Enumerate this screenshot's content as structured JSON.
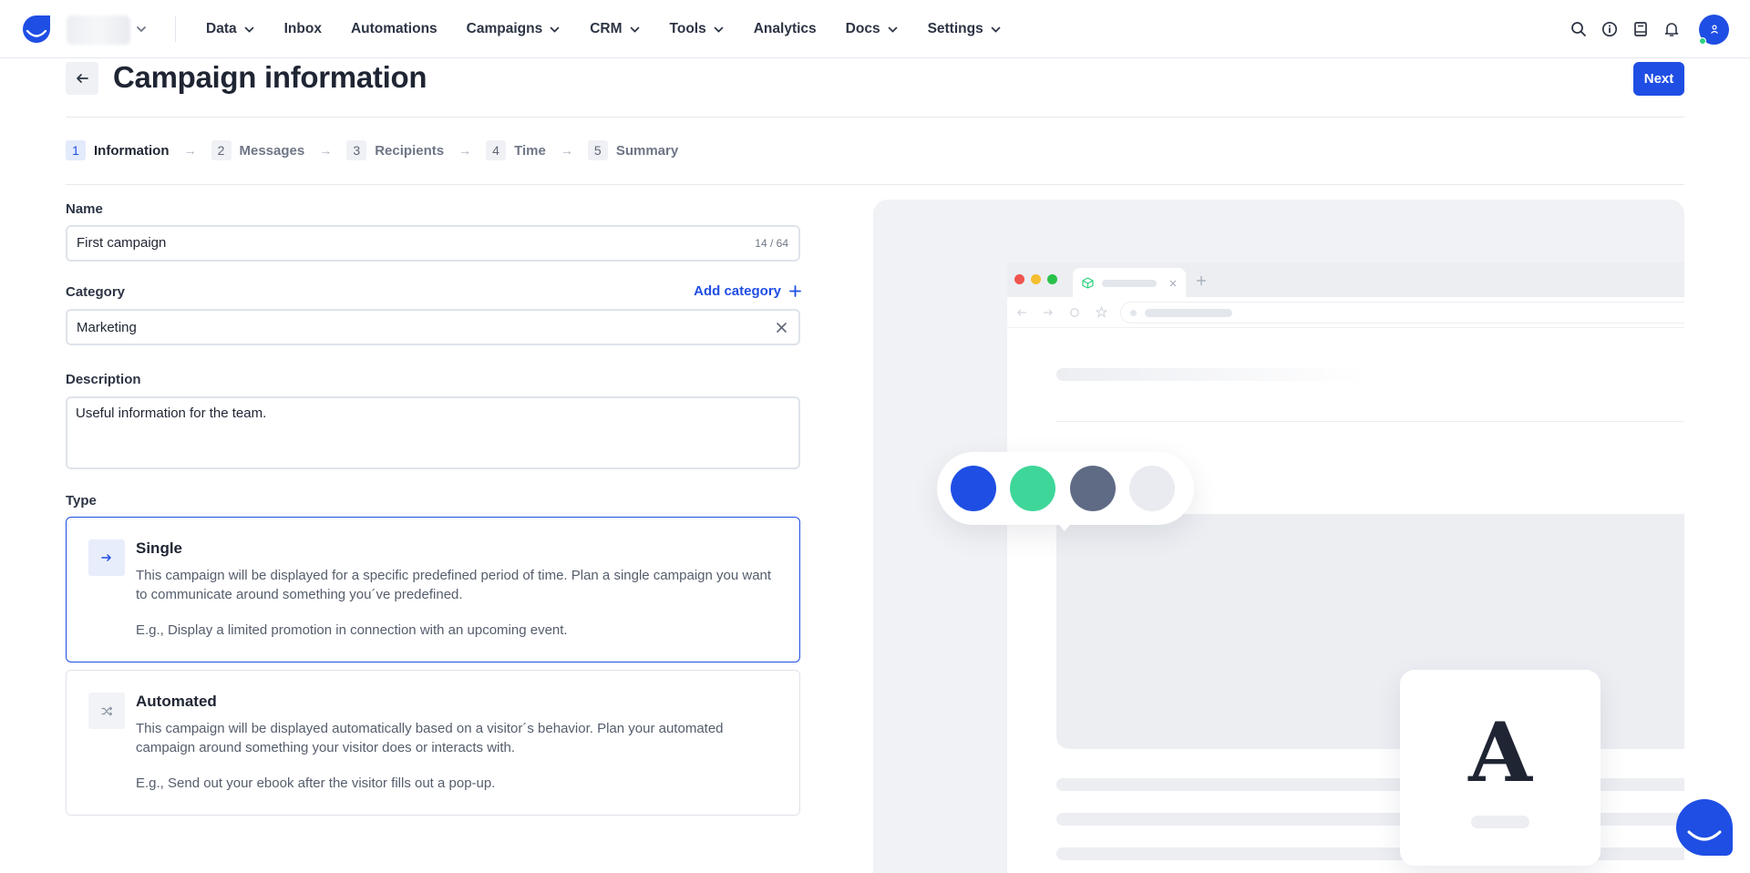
{
  "nav": {
    "items": [
      {
        "label": "Data",
        "dropdown": true
      },
      {
        "label": "Inbox",
        "dropdown": false
      },
      {
        "label": "Automations",
        "dropdown": false
      },
      {
        "label": "Campaigns",
        "dropdown": true
      },
      {
        "label": "CRM",
        "dropdown": true
      },
      {
        "label": "Tools",
        "dropdown": true
      },
      {
        "label": "Analytics",
        "dropdown": false
      },
      {
        "label": "Docs",
        "dropdown": true
      },
      {
        "label": "Settings",
        "dropdown": true
      }
    ],
    "icons": [
      "search-icon",
      "info-icon",
      "book-icon",
      "bell-icon"
    ]
  },
  "page": {
    "title": "Campaign information",
    "next_label": "Next"
  },
  "steps": [
    {
      "num": "1",
      "label": "Information",
      "active": true
    },
    {
      "num": "2",
      "label": "Messages",
      "active": false
    },
    {
      "num": "3",
      "label": "Recipients",
      "active": false
    },
    {
      "num": "4",
      "label": "Time",
      "active": false
    },
    {
      "num": "5",
      "label": "Summary",
      "active": false
    }
  ],
  "form": {
    "name_label": "Name",
    "name_value": "First campaign",
    "name_counter": "14 / 64",
    "category_label": "Category",
    "add_category_label": "Add category",
    "category_value": "Marketing",
    "description_label": "Description",
    "description_value": "Useful information for the team.",
    "type_label": "Type"
  },
  "types": {
    "single": {
      "title": "Single",
      "description": "This campaign will be displayed for a specific predefined period of time. Plan a single campaign you want to communicate around something you´ve predefined.",
      "example": "E.g., Display a limited promotion in connection with an upcoming event.",
      "selected": true
    },
    "automated": {
      "title": "Automated",
      "description": "This campaign will be displayed automatically based on a visitor´s behavior. Plan your automated campaign around something your visitor does or interacts with.",
      "example": "E.g., Send out your ebook after the visitor fills out a pop-up.",
      "selected": false
    }
  },
  "illustration": {
    "font_letter": "A",
    "palette_colors": [
      "#1f4ee4",
      "#3fd69a",
      "#5f6b85",
      "#e9ebf0"
    ]
  },
  "colors": {
    "accent": "#1f4ee4",
    "online": "#2bd17e"
  }
}
